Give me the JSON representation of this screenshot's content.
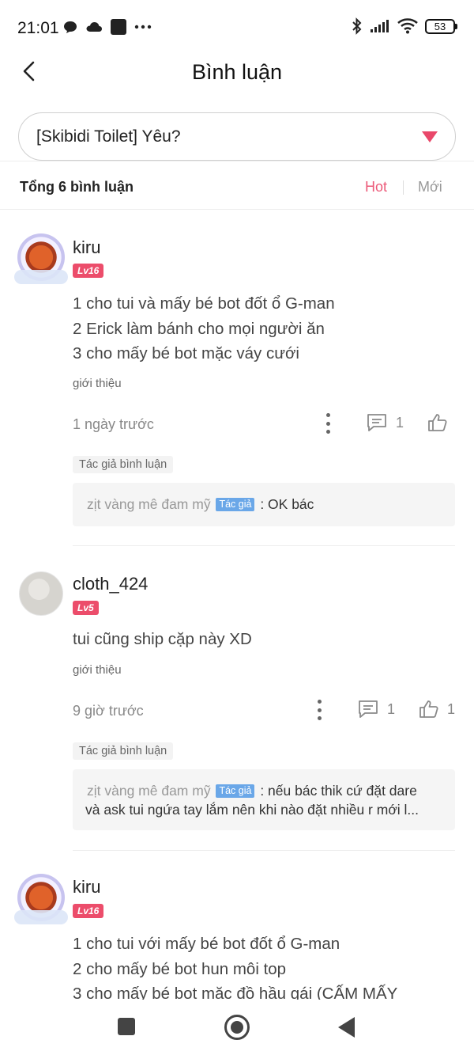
{
  "status_bar": {
    "time": "21:01",
    "left_icons": [
      "chat-bubble-icon",
      "cloud-icon",
      "app-square-icon",
      "more-dots-icon"
    ],
    "right_icons": [
      "bluetooth-icon",
      "signal-icon",
      "wifi-icon",
      "battery-icon"
    ],
    "battery": "53"
  },
  "header": {
    "title": "Bình luận",
    "back_icon": "chevron-left-icon"
  },
  "chapter_select": {
    "value": "[Skibidi Toilet] Yêu?"
  },
  "summary": {
    "count_label": "Tổng 6 bình luận",
    "sort_hot": "Hot",
    "sort_new": "Mới",
    "accent": "#ec5a79"
  },
  "comments": [
    {
      "username": "kiru",
      "level": "Lv16",
      "lines": [
        "1 cho tui và mấy bé bot đốt ổ G-man",
        "2 Erick làm bánh cho mọi người ăn",
        "3 cho mấy bé bot mặc váy cưới"
      ],
      "tag": "giới thiệu",
      "time": "1 ngày trước",
      "reply_count": "1",
      "like_count": "",
      "author_reply_chip": "Tác giả bình luận",
      "reply_author": "zịt vàng mê đam mỹ",
      "author_tag": "Tác giả",
      "reply_lines": [
        ": OK bác"
      ]
    },
    {
      "username": "cloth_424",
      "level": "Lv5",
      "lines": [
        "tui cũng ship cặp này XD"
      ],
      "tag": "giới thiệu",
      "time": "9 giờ trước",
      "reply_count": "1",
      "like_count": "1",
      "author_reply_chip": "Tác giả bình luận",
      "reply_author": "zịt vàng mê đam mỹ",
      "author_tag": "Tác giả",
      "reply_lines": [
        ": nếu bác thik cứ đặt dare",
        "và ask tui ngứa tay lắm nên khi nào đặt nhiều r mới l..."
      ]
    },
    {
      "username": "kiru",
      "level": "Lv16",
      "lines": [
        "1 cho tui với mấy bé bot đốt ổ G-man",
        "2 cho mấy bé bot hun môi top",
        "3 cho mấy bé bot mặc đồ hầu gái (CẤM MẤY"
      ]
    }
  ],
  "bottom_nav": {
    "items": [
      "recent-apps-button",
      "home-button",
      "back-button"
    ]
  }
}
